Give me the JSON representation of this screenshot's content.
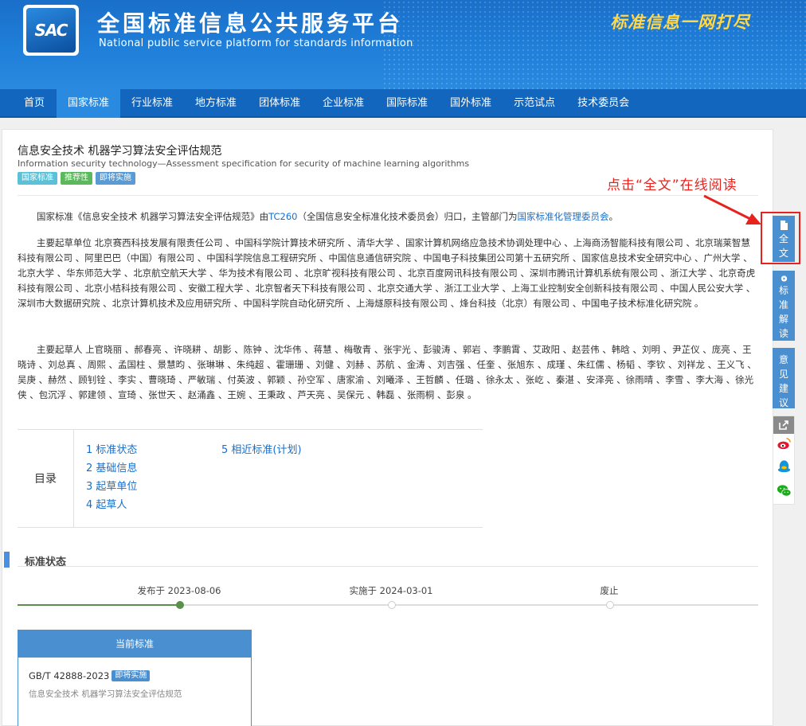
{
  "header": {
    "logo_text": "SAC",
    "title_cn": "全国标准信息公共服务平台",
    "title_en": "National public service platform  for standards information",
    "slogan": "标准信息一网打尽"
  },
  "nav": [
    "首页",
    "国家标准",
    "行业标准",
    "地方标准",
    "团体标准",
    "企业标准",
    "国际标准",
    "国外标准",
    "示范试点",
    "技术委员会"
  ],
  "standard": {
    "title_cn": "信息安全技术 机器学习算法安全评估规范",
    "title_en": "Information security technology—Assessment specification for security of machine learning algorithms",
    "tags": [
      "国家标准",
      "推荐性",
      "即将实施"
    ]
  },
  "intro": {
    "part1": "国家标准《信息安全技术 机器学习算法安全评估规范》由",
    "tc_link": "TC260",
    "part2": "（全国信息安全标准化技术委员会）归口，主管部门为",
    "dept_link": "国家标准化管理委员会",
    "part3": "。"
  },
  "drafting_units": "主要起草单位 北京赛西科技发展有限责任公司 、中国科学院计算技术研究所 、清华大学 、国家计算机网络应急技术协调处理中心 、上海商汤智能科技有限公司 、北京瑞莱智慧科技有限公司 、阿里巴巴（中国）有限公司 、中国科学院信息工程研究所 、中国信息通信研究院 、中国电子科技集团公司第十五研究所 、国家信息技术安全研究中心 、广州大学 、北京大学 、华东师范大学 、北京航空航天大学 、华为技术有限公司 、北京旷视科技有限公司 、北京百度网讯科技有限公司 、深圳市腾讯计算机系统有限公司 、浙江大学 、北京奇虎科技有限公司 、北京小桔科技有限公司 、安徽工程大学 、北京智者天下科技有限公司 、北京交通大学 、浙江工业大学 、上海工业控制安全创新科技有限公司 、中国人民公安大学 、深圳市大数据研究院 、北京计算机技术及应用研究所 、中国科学院自动化研究所 、上海燧原科技有限公司 、烽台科技（北京）有限公司 、中国电子技术标准化研究院 。",
  "drafters": "主要起草人 上官晓丽 、郝春亮 、许晓耕 、胡影 、陈钟 、沈华伟 、蒋慧 、梅敬青 、张宇光 、彭骏涛 、郭岩 、李鹏霄 、艾政阳 、赵芸伟 、韩晗 、刘明 、尹芷仪 、庞亮 、王晓诗 、刘总真 、周熙 、孟国柱 、景慧昀 、张琳琳 、朱纯超 、霍珊珊 、刘健 、刘赫 、苏航 、金涛 、刘吉强 、任奎 、张旭东 、成瑾 、朱红儒 、杨韬 、李钦 、刘祥龙 、王义飞 、吴庚 、赫然 、顾钊铨 、李实 、曹晓琦 、严敏瑞 、付英波 、郭颖 、孙空军 、唐家渝 、刘曦泽 、王哲麟 、任璐 、徐永太 、张屹 、秦湛 、安泽亮 、徐雨晴 、李雪 、李大海 、徐光侠 、包沉浮 、郭建领 、宣琦 、张世天 、赵涌鑫 、王婉 、王秉政 、芦天亮 、吴保元 、韩磊 、张雨桐 、彭泉 。",
  "toc": {
    "label": "目录",
    "col1": [
      "1  标准状态",
      "2  基础信息",
      "3  起草单位",
      "4  起草人"
    ],
    "col2": [
      "5  相近标准(计划)"
    ]
  },
  "status": {
    "title": "标准状态",
    "timeline": [
      {
        "label": "发布于 2023-08-06",
        "done": true
      },
      {
        "label": "实施于 2024-03-01",
        "done": false
      },
      {
        "label": "废止",
        "done": false
      }
    ],
    "current": {
      "header": "当前标准",
      "code": "GB/T 42888-2023",
      "tag": "即将实施",
      "name": "信息安全技术 机器学习算法安全评估规范"
    }
  },
  "annotation": "点击“全文”在线阅读",
  "sidebar": {
    "fulltext": [
      "全",
      "文"
    ],
    "interpret": [
      "标",
      "准",
      "解",
      "读"
    ],
    "feedback": [
      "意",
      "见",
      "建",
      "议"
    ]
  },
  "colors": {
    "header_blue": "#1f7fd9",
    "nav_blue": "#1266bd",
    "nav_active": "#2a8ae0",
    "accent_blue": "#4a8fd0",
    "annotation_red": "#e8231d",
    "timeline_green": "#5a8f4c"
  }
}
